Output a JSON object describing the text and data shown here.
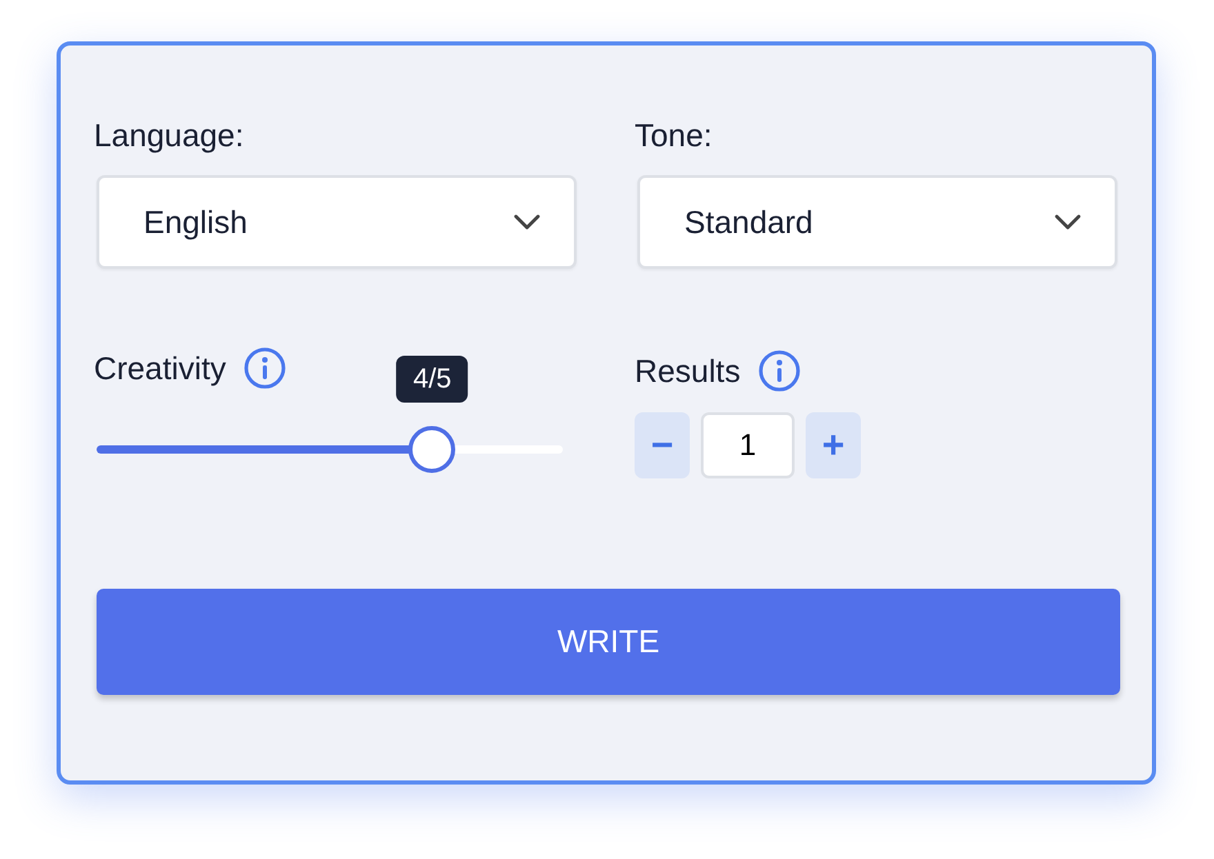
{
  "language": {
    "label": "Language:",
    "value": "English"
  },
  "tone": {
    "label": "Tone:",
    "value": "Standard"
  },
  "creativity": {
    "label": "Creativity",
    "level": 0.72,
    "tooltip": "4/5"
  },
  "results": {
    "label": "Results",
    "value": "1",
    "minus": "−",
    "plus": "+"
  },
  "button": "WRITE"
}
